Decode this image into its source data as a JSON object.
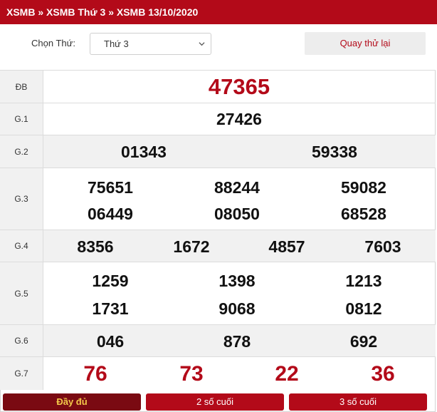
{
  "header": {
    "breadcrumb": [
      "XSMB",
      "XSMB Thứ 3",
      "XSMB 13/10/2020"
    ],
    "separator": "»"
  },
  "controls": {
    "day_label": "Chọn Thứ:",
    "day_select_value": "Thứ 3",
    "back_button_label": "Quay thử lại"
  },
  "prizes": [
    {
      "label": "ĐB",
      "numbers": [
        "47365"
      ]
    },
    {
      "label": "G.1",
      "numbers": [
        "27426"
      ]
    },
    {
      "label": "G.2",
      "numbers": [
        "01343",
        "59338"
      ]
    },
    {
      "label": "G.3",
      "numbers": [
        "75651",
        "88244",
        "59082",
        "06449",
        "08050",
        "68528"
      ]
    },
    {
      "label": "G.4",
      "numbers": [
        "8356",
        "1672",
        "4857",
        "7603"
      ]
    },
    {
      "label": "G.5",
      "numbers": [
        "1259",
        "1398",
        "1213",
        "1731",
        "9068",
        "0812"
      ]
    },
    {
      "label": "G.6",
      "numbers": [
        "046",
        "878",
        "692"
      ]
    },
    {
      "label": "G.7",
      "numbers": [
        "76",
        "73",
        "22",
        "36"
      ]
    }
  ],
  "tabs": [
    {
      "label": "Đầy đủ",
      "active": true
    },
    {
      "label": "2 số cuối",
      "active": false
    },
    {
      "label": "3 số cuối",
      "active": false
    }
  ],
  "colors": {
    "brand_red": "#b30a19",
    "active_tab_bg": "#7a0a12",
    "active_tab_text": "#f4c94a",
    "row_alt_bg": "#f1f1f1"
  }
}
